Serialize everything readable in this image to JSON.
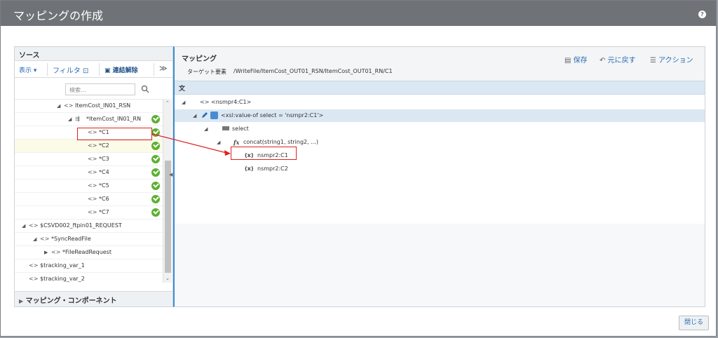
{
  "dialog": {
    "title": "マッピングの作成",
    "help_label": "?"
  },
  "source_panel": {
    "header": "ソース",
    "toolbar": {
      "view_label": "表示",
      "filter_label": "フィルタ",
      "disconnect_label": "連結解除",
      "more_label": "≫"
    },
    "search_placeholder": "検索...",
    "tree": [
      {
        "label": "ItemCost_IN01_RSN",
        "expanded": true,
        "check": false
      },
      {
        "label": "*ItemCost_IN01_RN",
        "expanded": true,
        "check": true
      },
      {
        "label": "*C1",
        "check": true
      },
      {
        "label": "*C2",
        "check": true
      },
      {
        "label": "*C3",
        "check": true
      },
      {
        "label": "*C4",
        "check": true
      },
      {
        "label": "*C5",
        "check": true
      },
      {
        "label": "*C6",
        "check": true
      },
      {
        "label": "*C7",
        "check": true
      },
      {
        "label": "$CSVD002_ftpin01_REQUEST",
        "expanded": true,
        "check": false
      },
      {
        "label": "*SyncReadFile",
        "expanded": true,
        "check": false
      },
      {
        "label": "*FileReadRequest",
        "expanded": false,
        "check": false
      },
      {
        "label": "$tracking_var_1",
        "check": false
      },
      {
        "label": "$tracking_var_2",
        "check": false
      }
    ],
    "footer": "マッピング・コンポーネント"
  },
  "mapping_panel": {
    "title": "マッピング",
    "target_label": "ターゲット要素",
    "target_value": "/WriteFile/ItemCost_OUT01_RSN/ItemCost_OUT01_RN/C1",
    "actions": {
      "save": "保存",
      "undo": "元に戻す",
      "actions": "アクション"
    },
    "statement_header": "文",
    "tree": [
      {
        "label": "<nsmpr4:C1>"
      },
      {
        "label": "<xsl:value-of select = 'nsmpr2:C1'>"
      },
      {
        "label": "select"
      },
      {
        "label": "concat(string1, string2, ...)"
      },
      {
        "label": "nsmpr2:C1"
      },
      {
        "label": "nsmpr2:C2"
      }
    ]
  },
  "footer": {
    "close_label": "閉じる"
  },
  "colors": {
    "title_bar": "#6f7378",
    "accent_blue": "#2a6db5",
    "highlight_red": "#e02020",
    "check_green": "#5cb030",
    "selection": "#dbe8f4"
  }
}
